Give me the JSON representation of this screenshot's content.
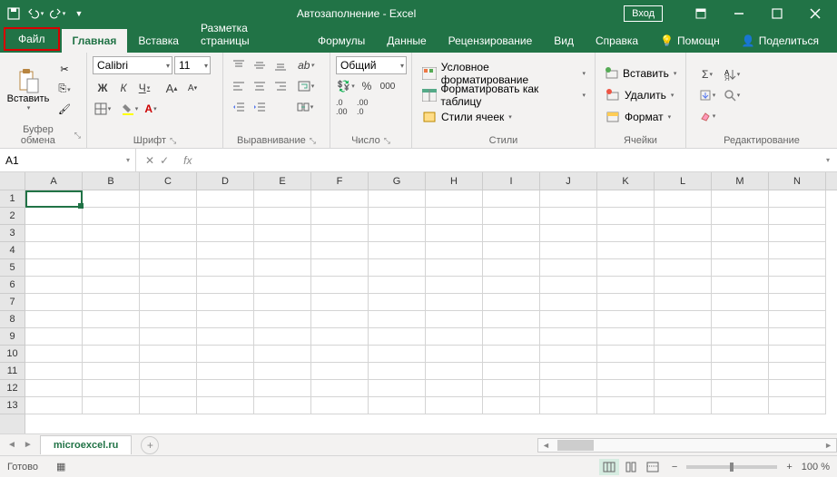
{
  "title": "Автозаполнение  -  Excel",
  "login": "Вход",
  "tabs": {
    "file": "Файл",
    "home": "Главная",
    "insert": "Вставка",
    "layout": "Разметка страницы",
    "formulas": "Формулы",
    "data": "Данные",
    "review": "Рецензирование",
    "view": "Вид",
    "help": "Справка",
    "assist": "Помощн",
    "share": "Поделиться"
  },
  "ribbon": {
    "clipboard": {
      "paste": "Вставить",
      "label": "Буфер обмена"
    },
    "font": {
      "name": "Calibri",
      "size": "11",
      "label": "Шрифт"
    },
    "align": {
      "label": "Выравнивание"
    },
    "number": {
      "format": "Общий",
      "label": "Число"
    },
    "styles": {
      "cond": "Условное форматирование",
      "table": "Форматировать как таблицу",
      "cell": "Стили ячеек",
      "label": "Стили"
    },
    "cells": {
      "insert": "Вставить",
      "delete": "Удалить",
      "format": "Формат",
      "label": "Ячейки"
    },
    "editing": {
      "label": "Редактирование"
    }
  },
  "namebox": "A1",
  "columns": [
    "A",
    "B",
    "C",
    "D",
    "E",
    "F",
    "G",
    "H",
    "I",
    "J",
    "K",
    "L",
    "M",
    "N"
  ],
  "rows": [
    "1",
    "2",
    "3",
    "4",
    "5",
    "6",
    "7",
    "8",
    "9",
    "10",
    "11",
    "12",
    "13"
  ],
  "sheet": "microexcel.ru",
  "status": "Готово",
  "zoom": "100 %"
}
